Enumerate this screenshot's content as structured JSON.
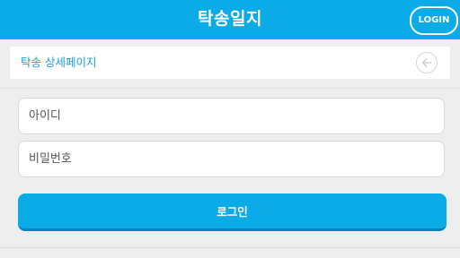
{
  "header": {
    "title": "탁송일지",
    "login_label": "LOGIN",
    "background_color": "#0aabe6"
  },
  "subheader": {
    "title": "탁송 상세페이지",
    "back_icon": "arrow-left-circle-icon",
    "title_color": "#1a9fd8"
  },
  "form": {
    "id_placeholder": "아이디",
    "id_value": "",
    "password_placeholder": "비밀번호",
    "password_value": "",
    "submit_label": "로그인",
    "submit_color": "#0aabe6"
  }
}
